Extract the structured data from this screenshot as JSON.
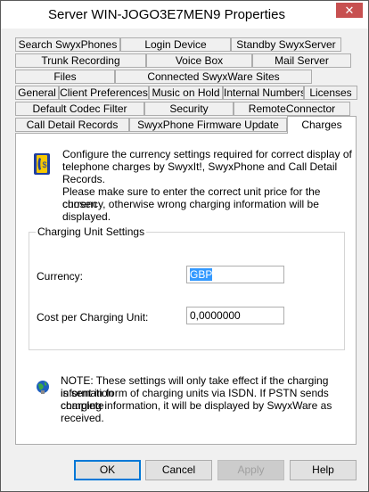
{
  "window": {
    "title": "Server WIN-JOGO3E7MEN9 Properties",
    "close_glyph": "✕"
  },
  "tabs": {
    "row1": [
      "Search SwyxPhones",
      "Login Device",
      "Standby SwyxServer"
    ],
    "row2": [
      "Trunk Recording",
      "Voice Box",
      "Mail Server"
    ],
    "row3": [
      "Files",
      "Connected SwyxWare Sites"
    ],
    "row4": [
      "General",
      "Client Preferences",
      "Music on Hold",
      "Internal Numbers",
      "Licenses"
    ],
    "row5": [
      "Default Codec Filter",
      "Security",
      "RemoteConnector"
    ],
    "row6": [
      "Call Detail Records",
      "SwyxPhone Firmware Update",
      "Charges"
    ],
    "active": "Charges"
  },
  "charges": {
    "intro_line1": "Configure the currency settings required for correct display of",
    "intro_line2": "telephone charges by SwyxIt!, SwyxPhone and Call Detail Records.",
    "warn_line1": "Please make sure to enter the correct unit price for the chosen",
    "warn_line2": "currency, otherwise wrong charging information will be displayed.",
    "group_label": "Charging Unit Settings",
    "currency_label": "Currency:",
    "currency_value": "GBP",
    "cost_label": "Cost per Charging Unit:",
    "cost_value": "0,0000000",
    "note_line1": "NOTE: These settings will only take effect if the charging information",
    "note_line2": "is sent in form of charging units via ISDN. If PSTN sends complete",
    "note_line3": "charging information, it will be displayed by SwyxWare as received."
  },
  "buttons": {
    "ok": "OK",
    "cancel": "Cancel",
    "apply": "Apply",
    "help": "Help"
  },
  "icons": {
    "info": "phone-currency-icon",
    "note": "globe-note-icon"
  }
}
